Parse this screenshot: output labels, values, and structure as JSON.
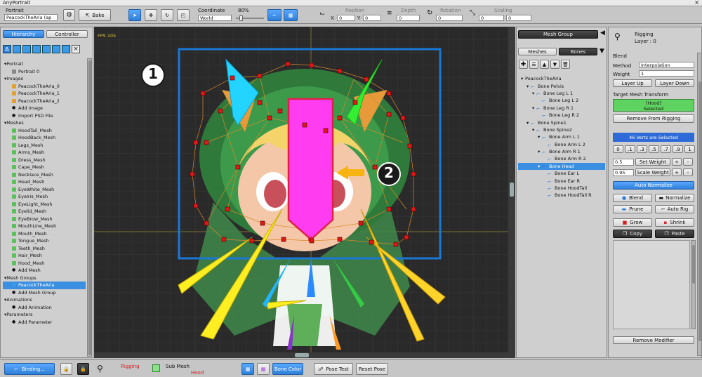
{
  "window": {
    "title": "AnyPortrait"
  },
  "toolbar": {
    "portrait_label": "Portrait",
    "portrait_value": "PeacockTheAria (ap",
    "bake_label": "Bake",
    "coordinate_label": "Coordinate",
    "coordinate_value": "World",
    "zoom_value": "80%",
    "position_label": "Position",
    "pos_x_label": "X",
    "pos_x": "0",
    "pos_y_label": "Y",
    "pos_y": "0",
    "depth_label": "Depth",
    "depth_value": "0",
    "rotation_label": "Rotation",
    "rotation_value": "0",
    "scaling_label": "Scaling",
    "scale_x": "0",
    "scale_y": "0"
  },
  "left_panel": {
    "tabs": [
      "Hierarchy",
      "Controller"
    ],
    "tree": [
      {
        "label": "Portrait",
        "level": 0,
        "kind": "group"
      },
      {
        "label": "Portrait 0",
        "level": 1,
        "kind": "portrait"
      },
      {
        "label": "Images",
        "level": 0,
        "kind": "group"
      },
      {
        "label": "PeacockTheAria_0",
        "level": 1,
        "kind": "image"
      },
      {
        "label": "PeacockTheAria_1",
        "level": 1,
        "kind": "image"
      },
      {
        "label": "PeacockTheAria_2",
        "level": 1,
        "kind": "image"
      },
      {
        "label": "Add Image",
        "level": 1,
        "kind": "add"
      },
      {
        "label": "Import PSD File",
        "level": 1,
        "kind": "add"
      },
      {
        "label": "Meshes",
        "level": 0,
        "kind": "group"
      },
      {
        "label": "HoodTail_Mesh",
        "level": 1,
        "kind": "mesh"
      },
      {
        "label": "HoodBack_Mesh",
        "level": 1,
        "kind": "mesh"
      },
      {
        "label": "Legs_Mesh",
        "level": 1,
        "kind": "mesh"
      },
      {
        "label": "Arms_Mesh",
        "level": 1,
        "kind": "mesh"
      },
      {
        "label": "Dress_Mesh",
        "level": 1,
        "kind": "mesh"
      },
      {
        "label": "Cape_Mesh",
        "level": 1,
        "kind": "mesh"
      },
      {
        "label": "Necklace_Mesh",
        "level": 1,
        "kind": "mesh"
      },
      {
        "label": "Head_Mesh",
        "level": 1,
        "kind": "mesh"
      },
      {
        "label": "EyeWhite_Mesh",
        "level": 1,
        "kind": "mesh"
      },
      {
        "label": "EyeIris_Mesh",
        "level": 1,
        "kind": "mesh"
      },
      {
        "label": "EyeLight_Mesh",
        "level": 1,
        "kind": "mesh"
      },
      {
        "label": "Eyelid_Mesh",
        "level": 1,
        "kind": "mesh"
      },
      {
        "label": "EyeBrow_Mesh",
        "level": 1,
        "kind": "mesh"
      },
      {
        "label": "MouthLine_Mesh",
        "level": 1,
        "kind": "mesh"
      },
      {
        "label": "Mouth_Mesh",
        "level": 1,
        "kind": "mesh"
      },
      {
        "label": "Tongue_Mesh",
        "level": 1,
        "kind": "mesh"
      },
      {
        "label": "Teeth_Mesh",
        "level": 1,
        "kind": "mesh"
      },
      {
        "label": "Hair_Mesh",
        "level": 1,
        "kind": "mesh"
      },
      {
        "label": "Hood_Mesh",
        "level": 1,
        "kind": "mesh"
      },
      {
        "label": "Add Mesh",
        "level": 1,
        "kind": "add"
      },
      {
        "label": "Mesh Groups",
        "level": 0,
        "kind": "group"
      },
      {
        "label": "PeacockTheAria",
        "level": 1,
        "kind": "meshgroup",
        "selected": true
      },
      {
        "label": "Add Mesh Group",
        "level": 1,
        "kind": "add"
      },
      {
        "label": "Animations",
        "level": 0,
        "kind": "group"
      },
      {
        "label": "Add Animation",
        "level": 1,
        "kind": "add"
      },
      {
        "label": "Parameters",
        "level": 0,
        "kind": "group"
      },
      {
        "label": "Add Parameter",
        "level": 1,
        "kind": "add"
      }
    ]
  },
  "viewport": {
    "fps": "FPS 105",
    "callout_1": "1",
    "callout_2": "2"
  },
  "mesh_group_panel": {
    "header": "Mesh Group",
    "tabs": [
      "Meshes",
      "Bones"
    ],
    "bones": [
      {
        "label": "PeacockTheAria",
        "level": 0
      },
      {
        "label": "Bone Pelvis",
        "level": 1
      },
      {
        "label": "Bone Leg L 1",
        "level": 2
      },
      {
        "label": "Bone Leg L 2",
        "level": 3
      },
      {
        "label": "Bone Leg R 1",
        "level": 2
      },
      {
        "label": "Bone Leg R 2",
        "level": 3
      },
      {
        "label": "Bone Spine1",
        "level": 1
      },
      {
        "label": "Bone Spine2",
        "level": 2
      },
      {
        "label": "Bone Arm L 1",
        "level": 3
      },
      {
        "label": "Bone Arm L 2",
        "level": 4
      },
      {
        "label": "Bone Arm R 1",
        "level": 3
      },
      {
        "label": "Bone Arm R 2",
        "level": 4
      },
      {
        "label": "Bone Head",
        "level": 3,
        "selected": true
      },
      {
        "label": "Bone Ear L",
        "level": 4
      },
      {
        "label": "Bone Ear R",
        "level": 4
      },
      {
        "label": "Bone HoodTail",
        "level": 4
      },
      {
        "label": "Bone HoodTail R",
        "level": 4
      }
    ]
  },
  "rigging_panel": {
    "title": "Rigging",
    "layer": "Layer : 0",
    "blend_label": "Blend",
    "method_label": "Method",
    "method_value": "Interpolation",
    "weight_label": "Weight",
    "weight_value": "1",
    "layer_up": "Layer Up",
    "layer_down": "Layer Down",
    "target_label": "Target Mesh Transform",
    "target_name": "[Hood]",
    "target_state": "Selected",
    "remove_from_rigging": "Remove From Rigging",
    "verts_selected": "46 Verts are Selected",
    "presets": [
      "0",
      ".1",
      ".3",
      ".5",
      ".7",
      ".9",
      "1"
    ],
    "set_weight_value": "0.5",
    "set_weight": "Set Weight",
    "scale_weight_value": "0.95",
    "scale_weight": "Scale Weight",
    "plus": "+",
    "minus": "-",
    "auto_normalize": "Auto Normalize",
    "blend": "Blend",
    "normalize": "Normalize",
    "prune": "Prune",
    "auto_rig": "Auto Rig",
    "grow": "Grow",
    "shrink": "Shrink",
    "copy": "Copy",
    "paste": "Paste",
    "remove_modifier": "Remove Modifier"
  },
  "bottom_bar": {
    "binding": "Binding...",
    "rigging_label": "Rigging",
    "submesh_label": "Sub Mesh",
    "submesh_value": "Hood",
    "bone_color": "Bone Color",
    "pose_test": "Pose Test",
    "reset_pose": "Reset Pose"
  },
  "colors": {
    "accent": "#3b8fe0",
    "rigging_red": "#d42020",
    "target_green": "#5fd35f",
    "magenta_bone": "#ff3cf0",
    "callout_box": "#1a78d6"
  }
}
